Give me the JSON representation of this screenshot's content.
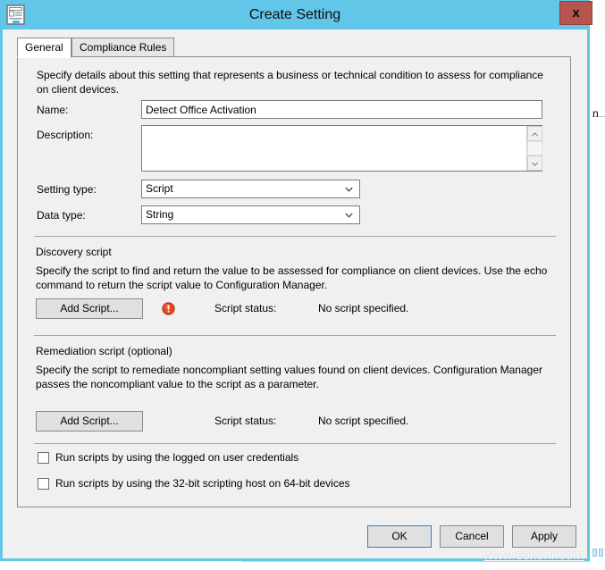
{
  "window": {
    "title": "Create Setting",
    "icon": "setting-document-icon",
    "close_label": "x",
    "titlebar_color": "#62c6e8",
    "close_color": "#b6544d"
  },
  "tabs": [
    {
      "label": "General",
      "active": true
    },
    {
      "label": "Compliance Rules",
      "active": false
    }
  ],
  "general": {
    "intro": "Specify details about this setting that represents a business or technical condition to assess for compliance on client devices.",
    "name": {
      "label": "Name:",
      "value": "Detect Office Activation",
      "placeholder": ""
    },
    "description": {
      "label": "Description:",
      "value": "",
      "placeholder": ""
    },
    "setting_type": {
      "label": "Setting type:",
      "value": "Script"
    },
    "data_type": {
      "label": "Data type:",
      "value": "String"
    },
    "discovery_script": {
      "title": "Discovery script",
      "description": "Specify the script to find and return the value to be assessed for compliance on client devices. Use the echo command to return the script value to Configuration Manager.",
      "add_script_label": "Add Script...",
      "has_error_icon": true,
      "error_icon": "error-exclamation-icon",
      "status_label": "Script status:",
      "status_value": "No script specified."
    },
    "remediation_script": {
      "title": "Remediation script (optional)",
      "description": "Specify the script to remediate noncompliant setting values found on client devices. Configuration Manager passes the noncompliant value to the script as a parameter.",
      "add_script_label": "Add Script...",
      "has_error_icon": false,
      "status_label": "Script status:",
      "status_value": "No script specified."
    },
    "checkboxes": [
      {
        "label": "Run scripts by using the logged on user credentials",
        "checked": false
      },
      {
        "label": "Run scripts by using the 32-bit scripting host on 64-bit devices",
        "checked": false
      }
    ]
  },
  "footer": {
    "ok_label": "OK",
    "cancel_label": "Cancel",
    "apply_label": "Apply"
  },
  "watermark": {
    "text": "www.eskonr.com"
  },
  "background": {
    "stray_letter": "n"
  }
}
